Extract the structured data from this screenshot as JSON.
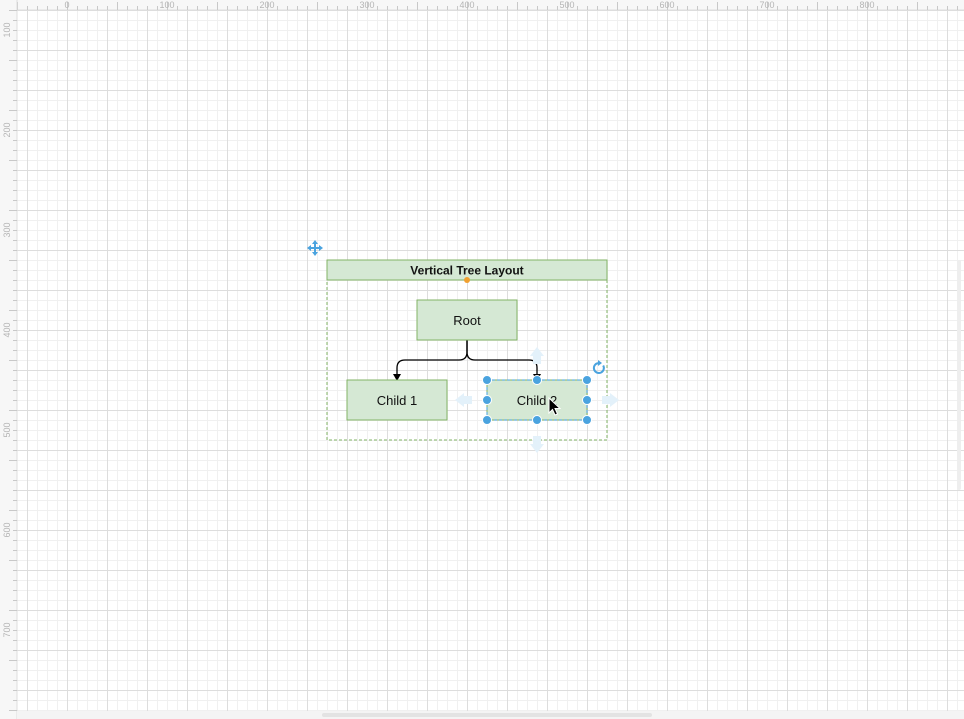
{
  "ruler": {
    "top_labels": [
      "0",
      "100",
      "200",
      "300",
      "400",
      "500",
      "600",
      "700",
      "800"
    ],
    "left_labels": [
      "100",
      "200",
      "300",
      "400",
      "500",
      "600",
      "700"
    ]
  },
  "diagram": {
    "container_title": "Vertical Tree Layout",
    "root_label": "Root",
    "child1_label": "Child 1",
    "child2_label": "Child 2"
  },
  "colors": {
    "shape_fill": "#d5e8d4",
    "shape_stroke": "#82b366",
    "selection": "#4aa3df",
    "grid_major": "#dddddd",
    "grid_minor": "#f0f0f0",
    "container_handle": "#f0a030"
  },
  "icons": {
    "move": "move-icon",
    "rotate": "rotate-icon",
    "cursor": "mouse-pointer-icon",
    "arrows": "hover-arrow-icon"
  }
}
